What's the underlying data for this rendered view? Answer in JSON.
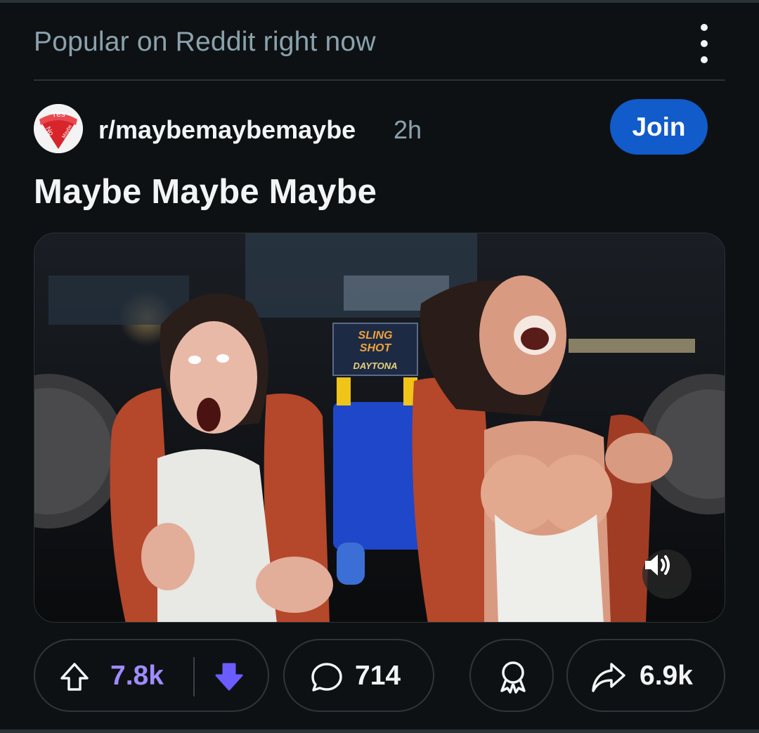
{
  "header": {
    "section_title": "Popular on Reddit right now",
    "more_icon": "kebab-vertical-icon"
  },
  "post": {
    "subreddit": "r/maybemaybemaybe",
    "age": "2h",
    "join_label": "Join",
    "title": "Maybe Maybe Maybe",
    "avatar_texts": {
      "yes": "Yes",
      "no": "No",
      "maybe": "Maybe"
    },
    "media": {
      "sign_line1": "SLING",
      "sign_line2": "SHOT",
      "sign_line3": "DAYTONA",
      "volume_icon": "volume-on-icon"
    }
  },
  "actions": {
    "upvote_count": "7.8k",
    "comment_count": "714",
    "share_count": "6.9k",
    "upvote_icon": "upvote-arrow-icon",
    "downvote_icon": "downvote-arrow-icon",
    "comment_icon": "comment-bubble-icon",
    "award_icon": "award-ribbon-icon",
    "share_icon": "share-arrow-icon"
  },
  "colors": {
    "background": "#0e1113",
    "join_blue": "#115bca",
    "upvoted_purple": "#9f8cff",
    "downvote_purple": "#6a5cff",
    "muted_text": "#8ba2ad"
  }
}
